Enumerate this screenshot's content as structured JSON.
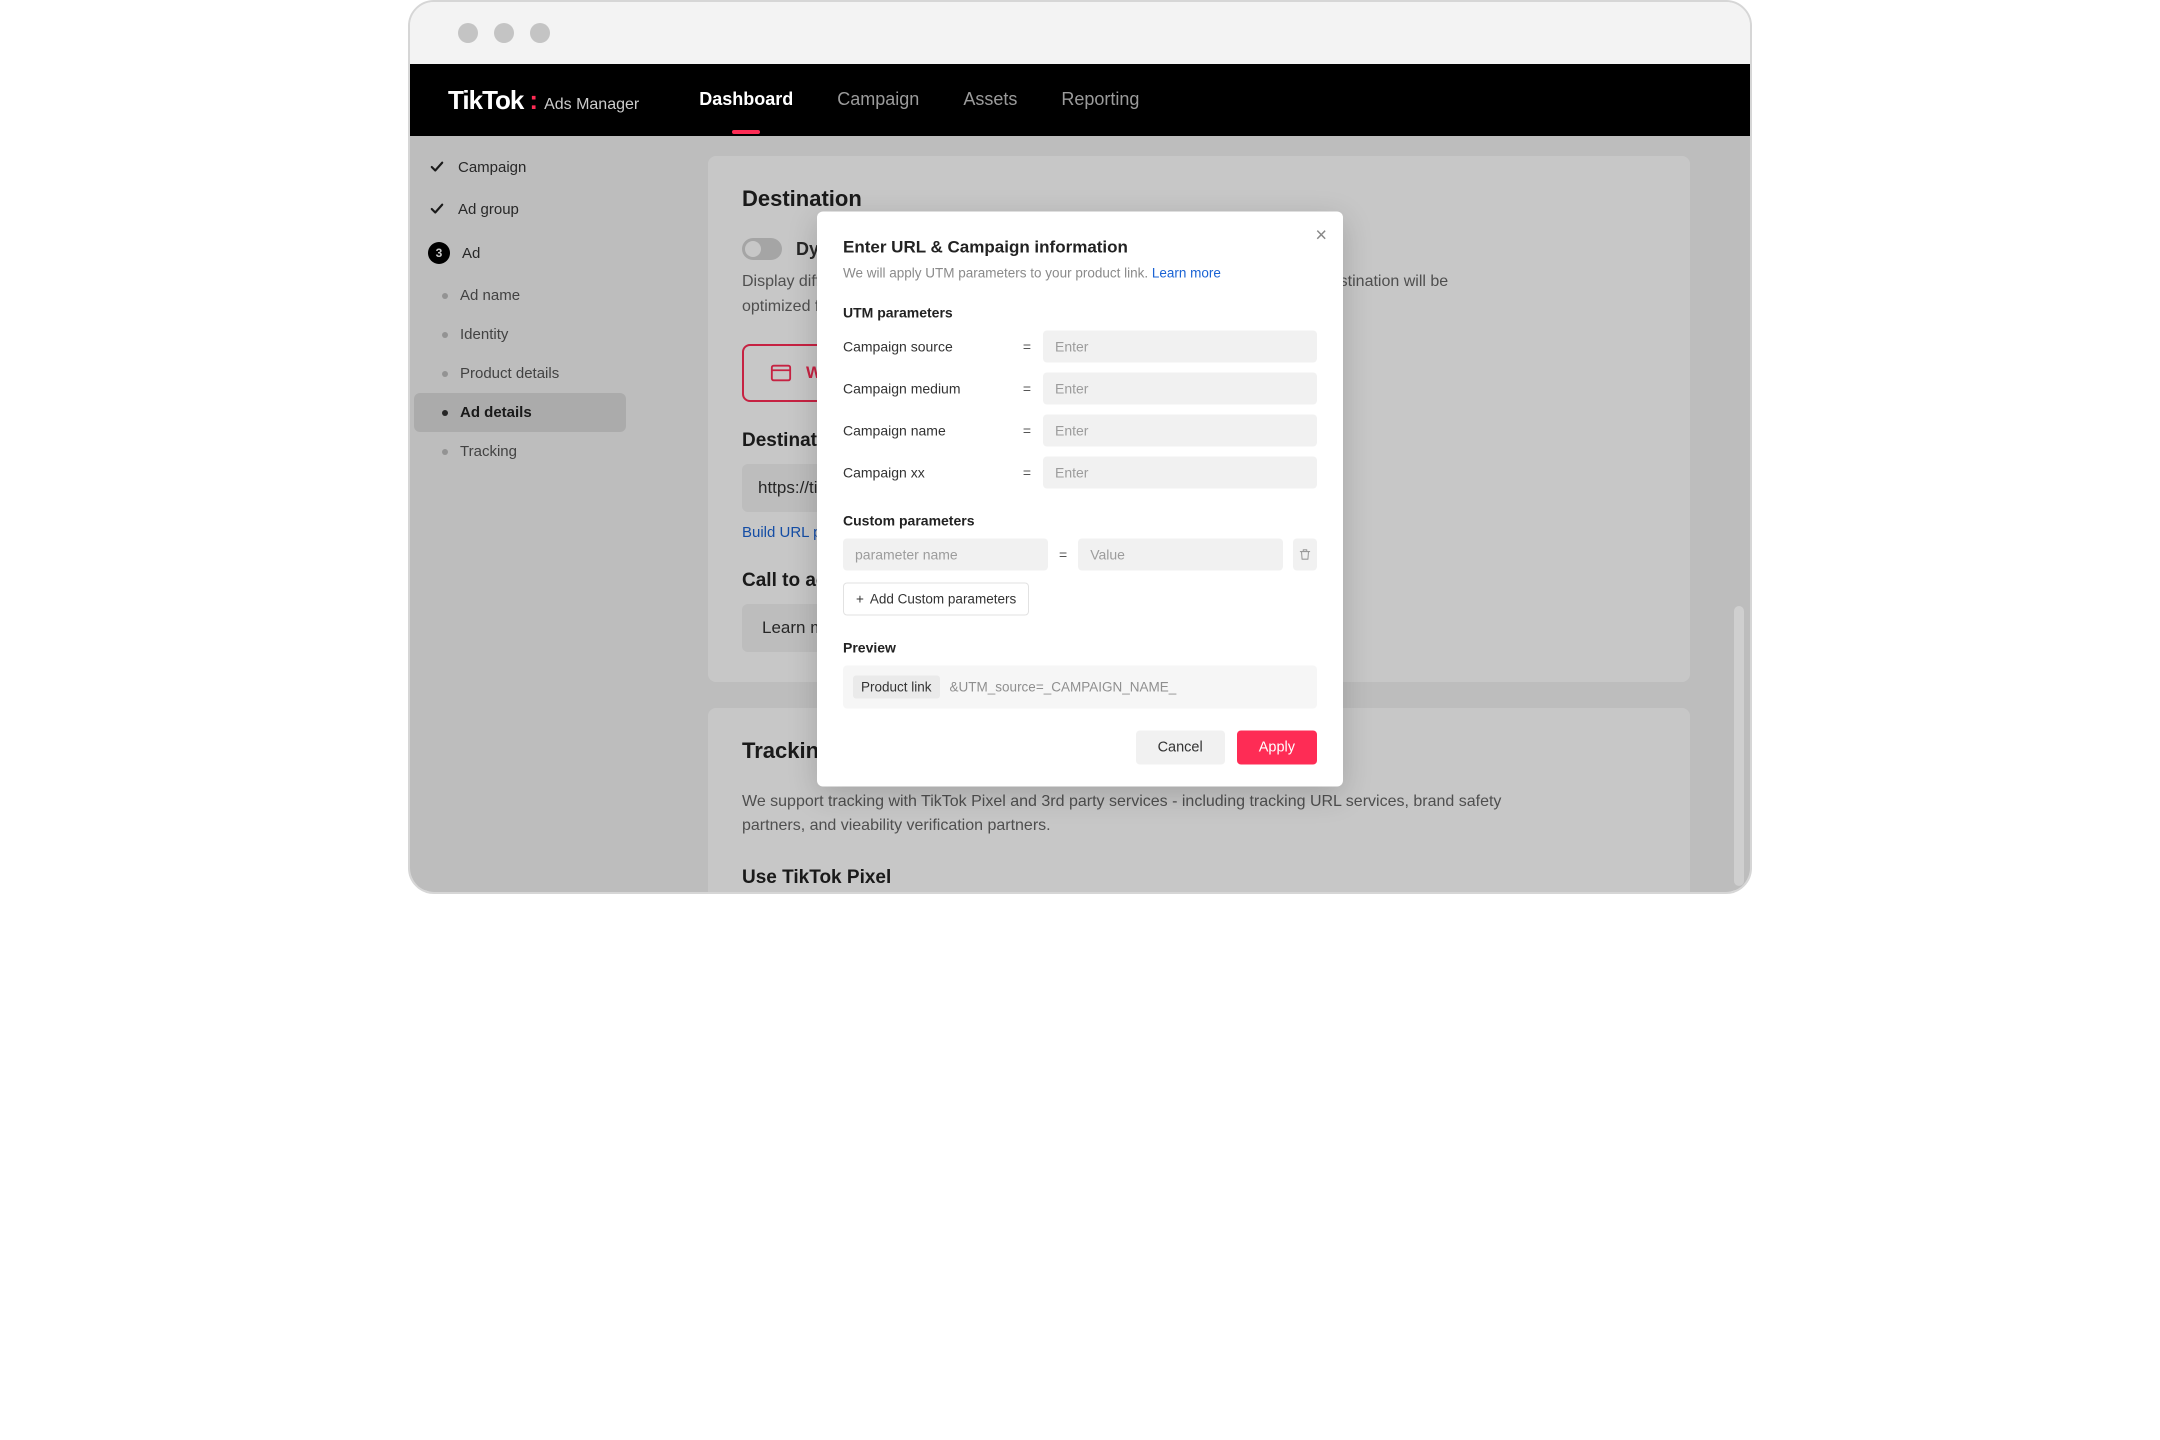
{
  "brand": {
    "main": "TikTok",
    "sub": "Ads Manager"
  },
  "nav": {
    "items": [
      {
        "label": "Dashboard",
        "active": true
      },
      {
        "label": "Campaign"
      },
      {
        "label": "Assets"
      },
      {
        "label": "Reporting"
      }
    ]
  },
  "sidebar": {
    "steps": [
      {
        "label": "Campaign",
        "done": true
      },
      {
        "label": "Ad group",
        "done": true
      },
      {
        "label": "Ad",
        "num": "3"
      }
    ],
    "subs": [
      {
        "label": "Ad name"
      },
      {
        "label": "Identity"
      },
      {
        "label": "Product details"
      },
      {
        "label": "Ad details",
        "active": true
      },
      {
        "label": "Tracking"
      }
    ]
  },
  "main": {
    "destination": {
      "title": "Destination",
      "toggle_label": "Dynamic destination",
      "description": "Display different destination pages to different users to maximize conversion. The destination will be optimized for each person based on their interest and intent.",
      "card_label": "We",
      "url_title": "Destination",
      "url_value": "https://ti",
      "build_link": "Build URL p",
      "cta_title": "Call to act",
      "cta_value": "Learn m"
    },
    "tracking": {
      "title": "Tracking",
      "description": "We support tracking with TikTok Pixel and 3rd party services - including tracking URL services, brand safety partners, and vieability verification partners.",
      "pixel_title": "Use TikTok Pixel"
    }
  },
  "modal": {
    "title": "Enter URL & Campaign information",
    "subtitle": "We will apply UTM parameters to your product link.",
    "learn_more": "Learn more",
    "utm_title": "UTM parameters",
    "utm_params": [
      {
        "label": "Campaign source",
        "placeholder": "Enter"
      },
      {
        "label": "Campaign medium",
        "placeholder": "Enter"
      },
      {
        "label": "Campaign name",
        "placeholder": "Enter"
      },
      {
        "label": "Campaign xx",
        "placeholder": "Enter"
      }
    ],
    "custom_title": "Custom parameters",
    "custom_name_placeholder": "parameter name",
    "custom_value_placeholder": "Value",
    "add_button": "Add Custom parameters",
    "preview_title": "Preview",
    "preview_chip": "Product link",
    "preview_text": "&UTM_source=_CAMPAIGN_NAME_",
    "cancel": "Cancel",
    "apply": "Apply"
  }
}
